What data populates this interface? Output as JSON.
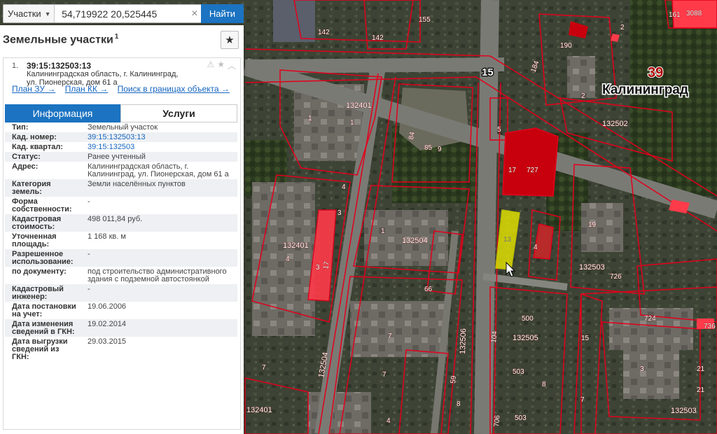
{
  "search": {
    "type_label": "Участки",
    "query": "54,719922 20,525445",
    "clear_symbol": "×",
    "find_label": "Найти"
  },
  "panel": {
    "title": "Земельные участки",
    "title_count": "1",
    "favorite_icon": "star-icon"
  },
  "result": {
    "index": "1.",
    "cad_number": "39:15:132503:13",
    "address_line1": "Калининградская область, г. Калининград,",
    "address_line2": "ул. Пионерская, дом 61 а",
    "link_plan_zu": "План ЗУ →",
    "link_plan_kk": "План КК →",
    "link_search": "Поиск в границах объекта →"
  },
  "tabs": {
    "info": "Информация",
    "services": "Услуги"
  },
  "info_rows": [
    {
      "k": "Тип:",
      "v": "Земельный участок"
    },
    {
      "k": "Кад. номер:",
      "v": "39:15:132503:13",
      "link": true
    },
    {
      "k": "Кад. квартал:",
      "v": "39:15:132503",
      "link": true
    },
    {
      "k": "Статус:",
      "v": "Ранее учтенный"
    },
    {
      "k": "Адрес:",
      "v": "Калининградская область, г. Калининград, ул. Пионерская, дом 61 а"
    },
    {
      "k": "Категория земель:",
      "v": "Земли населённых пунктов"
    },
    {
      "k": "Форма собственности:",
      "v": "-"
    },
    {
      "k": "Кадастровая стоимость:",
      "v": "498 011,84 руб."
    },
    {
      "k": "Уточненная площадь:",
      "v": "1 168 кв. м"
    },
    {
      "k": "Разрешенное использование:",
      "v": "-"
    },
    {
      "k": "по документу:",
      "v": "под строительство административного здания с подземной автостоянкой"
    },
    {
      "k": "Кадастровый инженер:",
      "v": "-"
    },
    {
      "k": "Дата постановки на учет:",
      "v": "19.06.2006"
    },
    {
      "k": "Дата изменения сведений в ГКН:",
      "v": "19.02.2014"
    },
    {
      "k": "Дата выгрузки сведений из ГКН:",
      "v": "29.03.2015"
    }
  ],
  "map": {
    "city": "Калининград",
    "region_code": "39",
    "road_number": "15",
    "parcel_color": "#e3001b",
    "selected_color": "#e8e800",
    "labels": {
      "q132401a": "132401",
      "q132401b": "132401",
      "q132401c": "132401",
      "q132504a": "132504",
      "q132504b": "132504",
      "q132506": "132506",
      "q132505": "132505",
      "q132503a": "132503",
      "q132503b": "132503",
      "q132502": "132502",
      "n142a": "142",
      "n142b": "142",
      "n155": "155",
      "n161": "161",
      "n3088": "3088",
      "n190": "190",
      "n2": "2",
      "n5": "5",
      "n17": "17",
      "n727": "727",
      "n85": "85",
      "n9": "9",
      "n84": "84",
      "n1a": "1",
      "n1b": "1",
      "n1c": "1",
      "n4a": "4",
      "n4b": "4",
      "n4c": "4",
      "n3a": "3",
      "n3b": "3",
      "n17b": "17",
      "n19": "19",
      "n726": "726",
      "n724": "724",
      "n736": "736",
      "n66": "66",
      "n500": "500",
      "n503a": "503",
      "n503b": "503",
      "n8a": "8",
      "n8b": "8",
      "n7a": "7",
      "n7b": "7",
      "n7c": "7",
      "n7d": "7",
      "n15": "15",
      "n3c": "3",
      "n21a": "21",
      "n21b": "21",
      "n59": "59",
      "n104": "104",
      "n13": "13",
      "n706": "706",
      "n184": "184",
      "n45": "4",
      "n2b": "2"
    }
  }
}
